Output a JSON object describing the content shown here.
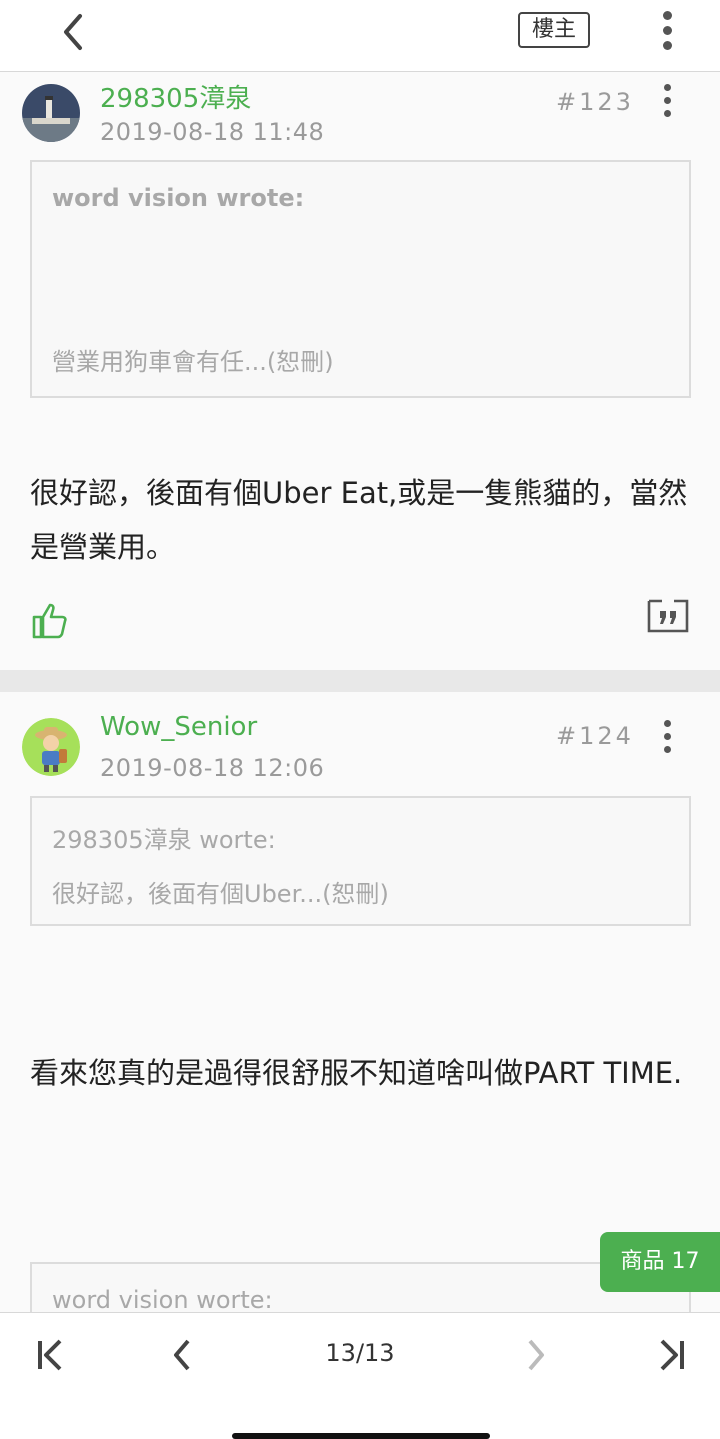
{
  "header": {
    "op_label": "樓主"
  },
  "posts": [
    {
      "author": "298305漳泉",
      "date": "2019-08-18 11:48",
      "floor": "#123",
      "quote": {
        "author": "word vision wrote:",
        "text": "營業用狗車會有任...(恕刪)"
      },
      "body": "很好認，後面有個Uber Eat,或是一隻熊貓的，當然是營業用。"
    },
    {
      "author": "Wow_Senior",
      "date": "2019-08-18 12:06",
      "floor": "#124",
      "quote": {
        "author": "298305漳泉 worte:",
        "text": "很好認，後面有個Uber...(恕刪)"
      },
      "body": "看來您真的是過得很舒服不知道啥叫做PART TIME.",
      "quote2": {
        "author": "word vision worte:"
      }
    }
  ],
  "product_button": {
    "label": "商品 17"
  },
  "pager": {
    "label": "13/13"
  },
  "colors": {
    "accent": "#4caf50",
    "muted": "#9a9a9a"
  },
  "icons": [
    "back-icon",
    "more-icon",
    "thumbs-up-icon",
    "quote-icon",
    "first-page-icon",
    "prev-page-icon",
    "next-page-icon",
    "last-page-icon"
  ]
}
